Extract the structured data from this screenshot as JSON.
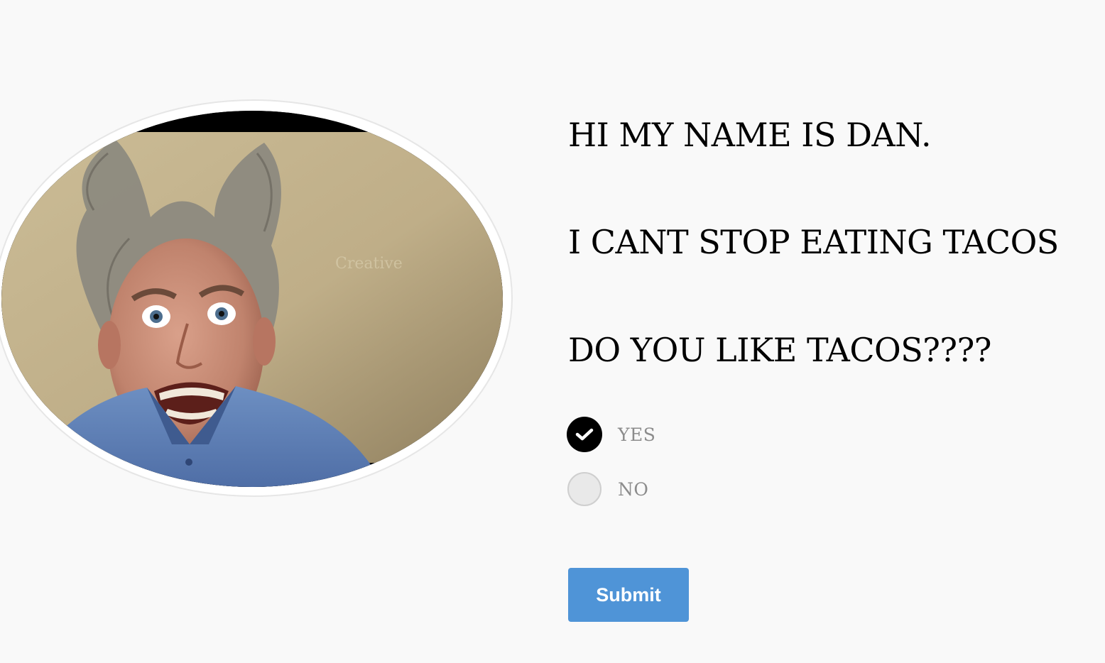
{
  "profile": {
    "photo_icon": "person-portrait-photo",
    "watermark": "Creative"
  },
  "content": {
    "lines": [
      "HI MY NAME IS DAN.",
      "I CANT STOP EATING TACOS",
      "DO YOU LIKE TACOS????"
    ]
  },
  "question": {
    "options": [
      {
        "label": "YES",
        "checked": true
      },
      {
        "label": "NO",
        "checked": false
      }
    ]
  },
  "submit": {
    "label": "Submit"
  },
  "colors": {
    "background": "#f9f9f9",
    "accent": "#4f94d7",
    "radio_checked": "#000000",
    "radio_unchecked": "#e9e9e9",
    "option_text": "#8c8c8c"
  }
}
